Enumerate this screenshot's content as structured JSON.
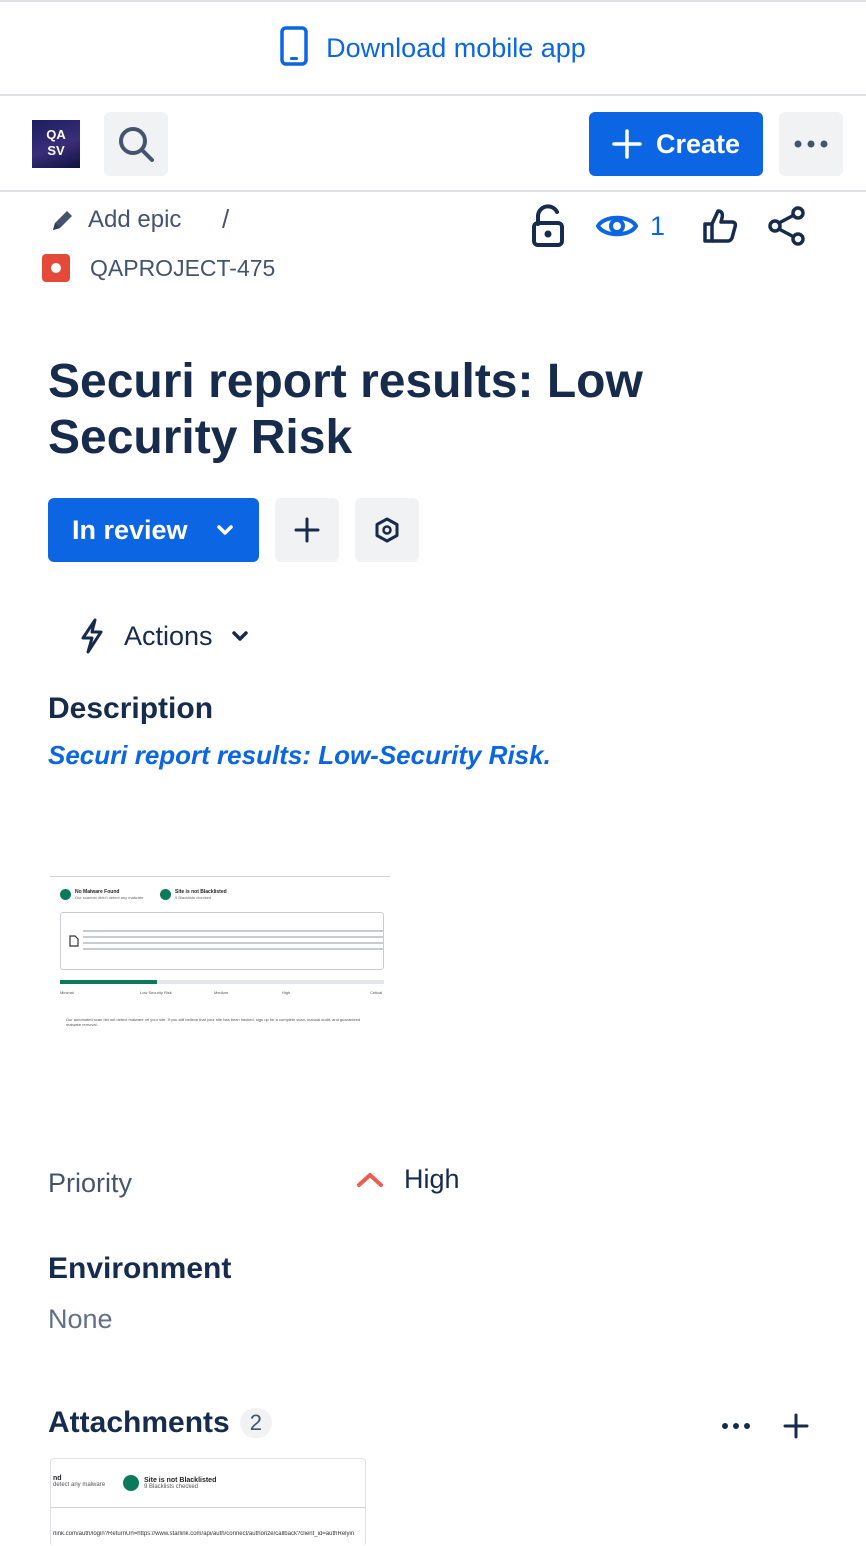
{
  "banner": {
    "label": "Download mobile app",
    "icon": "mobile-phone-icon"
  },
  "topbar": {
    "logo": {
      "line1": "QA",
      "line2": "SV"
    },
    "search_icon": "search-icon",
    "create_label": "Create",
    "more_icon": "more-horizontal-icon"
  },
  "breadcrumb": {
    "add_epic": "Add epic",
    "separator": "/",
    "issue_key": "QAPROJECT-475"
  },
  "issue_actions": {
    "watch_count": "1"
  },
  "issue": {
    "title": "Securi report results: Low Security Risk",
    "status": "In review",
    "actions_label": "Actions"
  },
  "description": {
    "heading": "Description",
    "text": "Securi report results: Low-Security Risk.",
    "screenshot": {
      "check1_title": "No Malware Found",
      "check1_sub": "Our scanner didn't detect any malware",
      "check2_title": "Site is not Blacklisted",
      "check2_sub": "9 Blacklists checked",
      "risk_labels": [
        "Minimal",
        "Low Security Risk",
        "Medium",
        "High",
        "Critical"
      ],
      "risk_level": 0.3,
      "footer": "Our automated scan did not detect malware on your site. If you still believe that your site has been hacked, sign up for a complete scan, manual audit, and guaranteed malware removal."
    }
  },
  "fields": {
    "priority_label": "Priority",
    "priority_value": "High",
    "priority_color": "#f15b50",
    "environment_label": "Environment",
    "environment_value": "None"
  },
  "attachments": {
    "heading": "Attachments",
    "count": "2",
    "preview": {
      "left_title": "nd",
      "left_sub": "detect any malware",
      "right_title": "Site is not Blacklisted",
      "right_sub": "9 Blacklists checked",
      "url": "rlink.com/auth/login?ReturnUrl=https://www.starlink.com/api/auth/connect/authorize/callback?client_id=authRelyin"
    }
  },
  "colors": {
    "primary": "#0c66e4",
    "text": "#172b4d",
    "subtle": "#44546f",
    "bug": "#e5493a"
  }
}
